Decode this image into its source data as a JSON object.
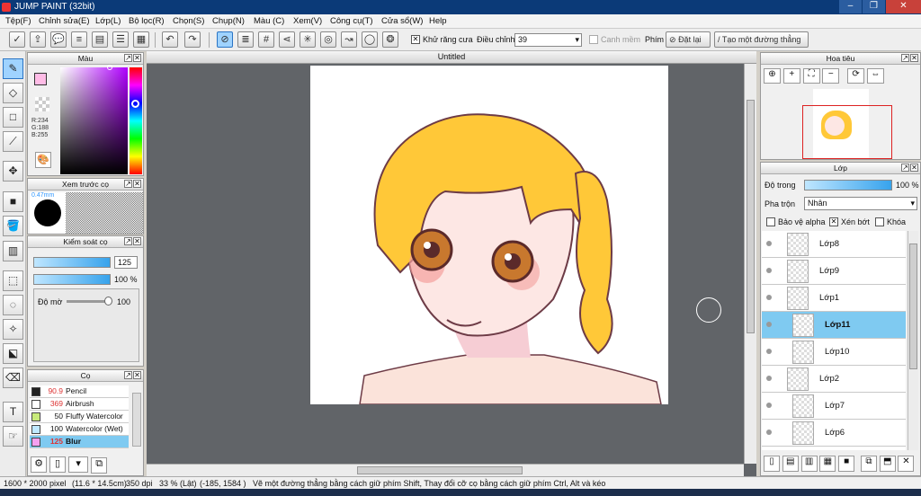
{
  "window": {
    "title": "JUMP PAINT (32bit)"
  },
  "menu": [
    "Tệp(F)",
    "Chỉnh sửa(E)",
    "Lớp(L)",
    "Bộ lọc(R)",
    "Chọn(S)",
    "Chụp(N)",
    "Màu (C)",
    "Xem(V)",
    "Công cụ(T)",
    "Cửa sổ(W)",
    "Help"
  ],
  "toolbar": {
    "antialias_label": "Khử răng cưa",
    "adjust_label": "Điều chỉnh",
    "adjust_value": "39",
    "smooth_label": "Canh mềm",
    "key_label": "Phím",
    "reset_label": "Đặt lại",
    "straight_line_label": "Tạo một đường thẳng"
  },
  "color_panel": {
    "title": "Màu",
    "r": "R:234",
    "g": "G:188",
    "b": "B:255",
    "fg": "#ffbce6",
    "bg": "#ffffff"
  },
  "brush_preview": {
    "title": "Xem trước cọ",
    "size_label": "0.47mm"
  },
  "brush_control": {
    "title": "Kiểm soát cọ",
    "size": "125",
    "opacity": "100 %",
    "density_label": "Độ mờ",
    "density": "100"
  },
  "brushes": {
    "title": "Cọ",
    "items": [
      {
        "size": "90.9",
        "name": "Pencil",
        "color": "#222222"
      },
      {
        "size": "369",
        "name": "Airbrush",
        "color": "#ffffff"
      },
      {
        "size": "50",
        "name": "Fluffy Watercolor",
        "color": "#c8ea7a"
      },
      {
        "size": "100",
        "name": "Watercolor (Wet)",
        "color": "#bfe9ff"
      },
      {
        "size": "125",
        "name": "Blur",
        "color": "#f6a0f0"
      }
    ]
  },
  "document": {
    "title": "Untitled"
  },
  "navigator": {
    "title": "Hoa tiêu"
  },
  "layers": {
    "title": "Lớp",
    "opacity_label": "Độ trong",
    "opacity": "100 %",
    "blend_label": "Pha trộn",
    "blend": "Nhân",
    "protect_alpha": "Bảo vệ alpha",
    "clipping": "Xén bớt",
    "lock": "Khóa",
    "items": [
      {
        "name": "Lớp8"
      },
      {
        "name": "Lớp9"
      },
      {
        "name": "Lớp1"
      },
      {
        "name": "Lớp11"
      },
      {
        "name": "Lớp10"
      },
      {
        "name": "Lớp2"
      },
      {
        "name": "Lớp7"
      },
      {
        "name": "Lớp6"
      }
    ]
  },
  "status": {
    "size": "1600 * 2000 pixel",
    "cm": "(11.6 * 14.5cm)",
    "dpi": "350 dpi",
    "zoom": "33 % (Lật)",
    "coords": "(-185, 1584 )",
    "hint": "Vẽ một đường thẳng bằng cách giữ phím Shift, Thay đổi cỡ cọ bằng cách giữ phím Ctrl, Alt và kéo"
  }
}
